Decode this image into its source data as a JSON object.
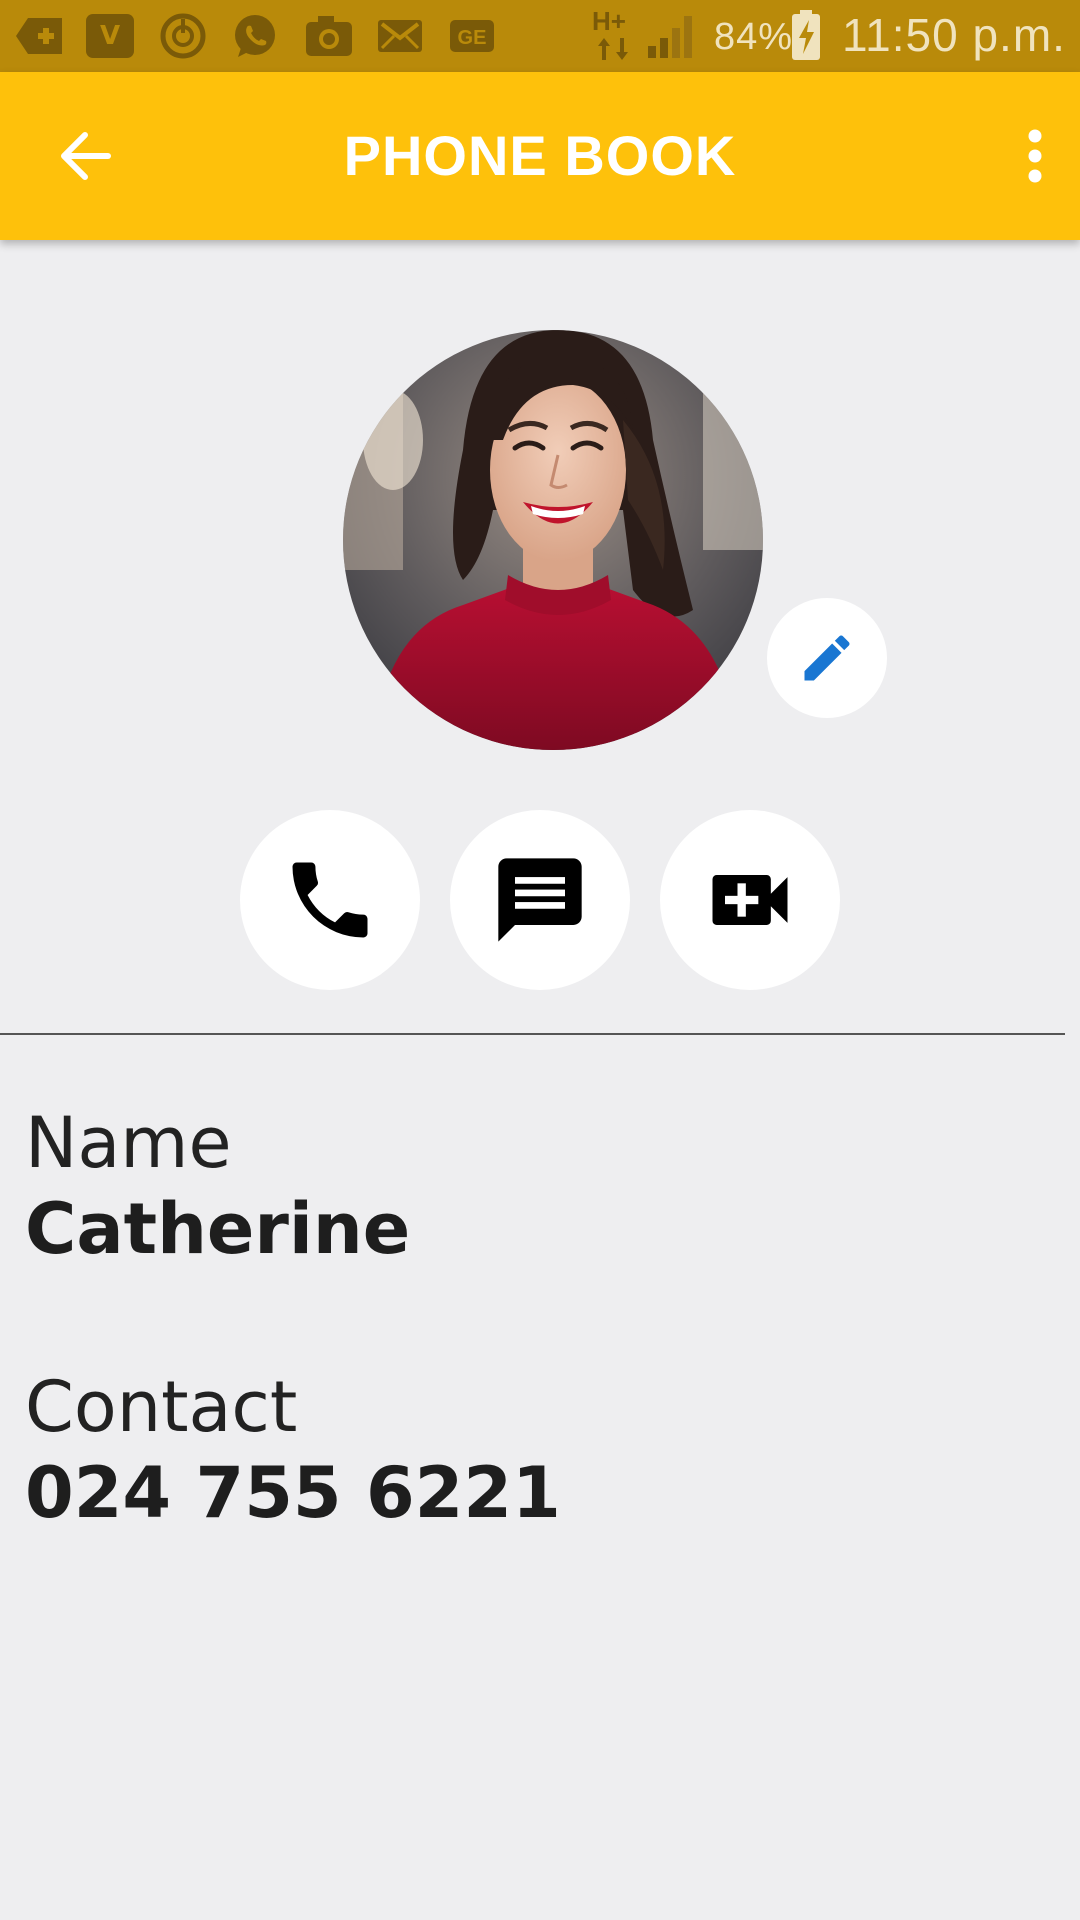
{
  "status_bar": {
    "signal_type": "H+",
    "battery": "84%",
    "time": "11:50 p.m."
  },
  "app_bar": {
    "title": "PHONE BOOK"
  },
  "contact": {
    "name_label": "Name",
    "name_value": "Catherine",
    "contact_label": "Contact",
    "contact_value": "024 755 6221"
  },
  "colors": {
    "app_bar": "#fec10b",
    "status_bar": "#b98a0a",
    "background": "#eeeef0",
    "edit_icon": "#1976d2"
  },
  "icons": {
    "back": "arrow-left-icon",
    "menu": "more-vert-icon",
    "edit": "pencil-icon",
    "call": "phone-icon",
    "message": "message-icon",
    "video": "video-call-icon"
  }
}
